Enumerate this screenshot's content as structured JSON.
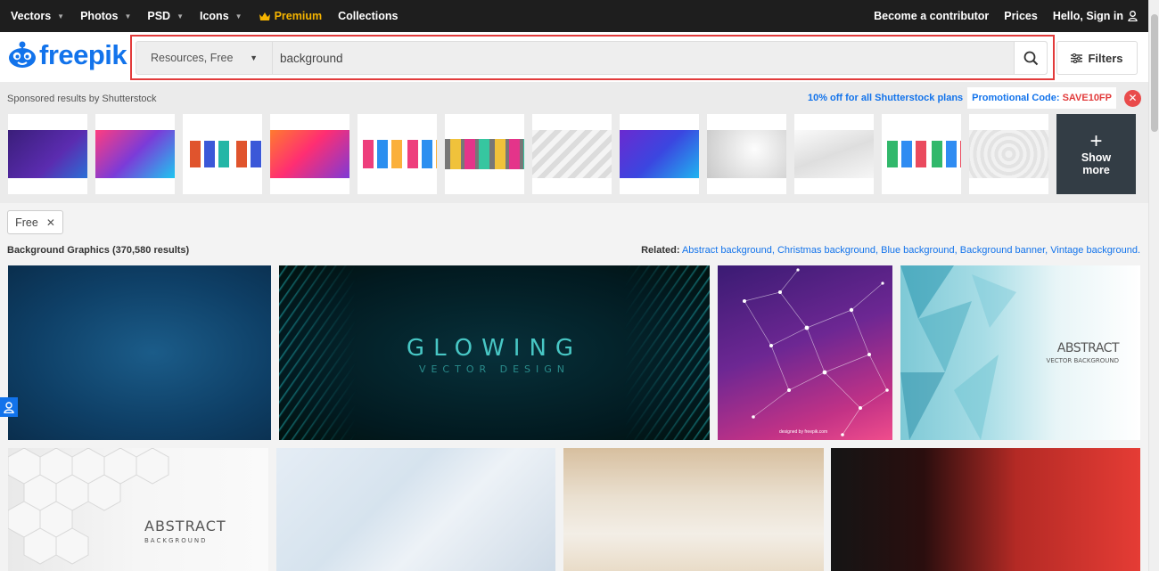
{
  "topnav": {
    "items": [
      {
        "label": "Vectors",
        "has_caret": true
      },
      {
        "label": "Photos",
        "has_caret": true
      },
      {
        "label": "PSD",
        "has_caret": true
      },
      {
        "label": "Icons",
        "has_caret": true
      }
    ],
    "premium": "Premium",
    "collections": "Collections",
    "become_contributor": "Become a contributor",
    "prices": "Prices",
    "sign_in": "Hello, Sign in"
  },
  "header": {
    "logo_text": "freepik",
    "resource_select": "Resources, Free",
    "search_value": "background",
    "filters_label": "Filters"
  },
  "sponsored": {
    "label": "Sponsored results by Shutterstock",
    "offer": "10% off for all Shutterstock plans",
    "promo_label": "Promotional Code:",
    "promo_code": "SAVE10FP",
    "show_more": [
      "Show",
      "more"
    ]
  },
  "filters": {
    "chip": "Free"
  },
  "results": {
    "title": "Background Graphics (370,580 results)",
    "related_label": "Related:",
    "related": "Abstract background, Christmas background, Blue background, Background banner, Vintage background."
  },
  "tiles": {
    "t2_title": "GLOWING",
    "t2_sub": "VECTOR DESIGN",
    "t3_credit": "designed by freepik.com",
    "t4_title": "ABSTRACT",
    "t4_sub": "VECTOR BACKGROUND",
    "t5_title": "ABSTRACT",
    "t5_sub": "BACKGROUND"
  },
  "colors": {
    "brand_blue": "#1273eb",
    "premium_gold": "#f5b400",
    "promo_red": "#e23b3b"
  }
}
